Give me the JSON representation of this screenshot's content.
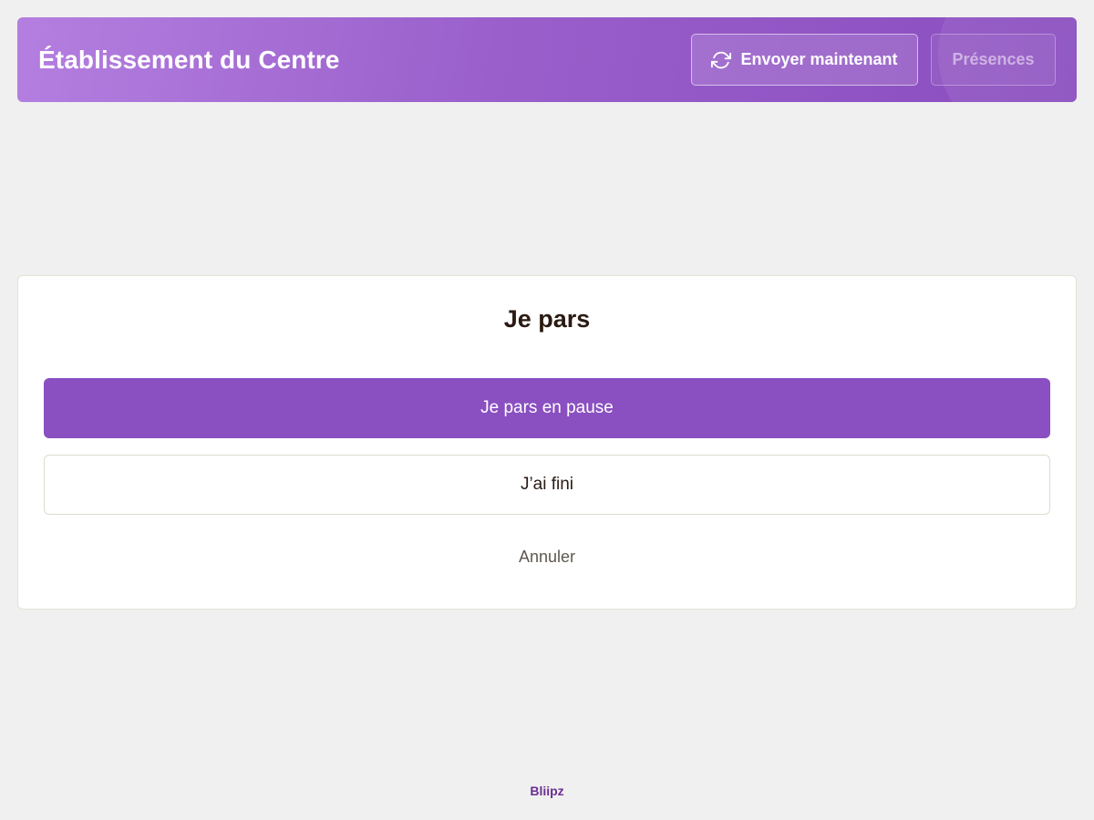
{
  "header": {
    "title": "Établissement du Centre",
    "sync_button_label": "Envoyer maintenant",
    "sync_icon": "refresh-icon",
    "presences_button_label": "Présences"
  },
  "dialog": {
    "title": "Je pars",
    "pause_button_label": "Je pars en pause",
    "finished_button_label": "J’ai fini",
    "cancel_label": "Annuler"
  },
  "footer": {
    "brand": "Bliipz"
  },
  "colors": {
    "accent": "#8a4fc0",
    "header_gradient_start": "#b47fe0",
    "header_gradient_end": "#8a4dbf",
    "brand_text": "#6b2f91",
    "background": "#f0f0f0"
  }
}
